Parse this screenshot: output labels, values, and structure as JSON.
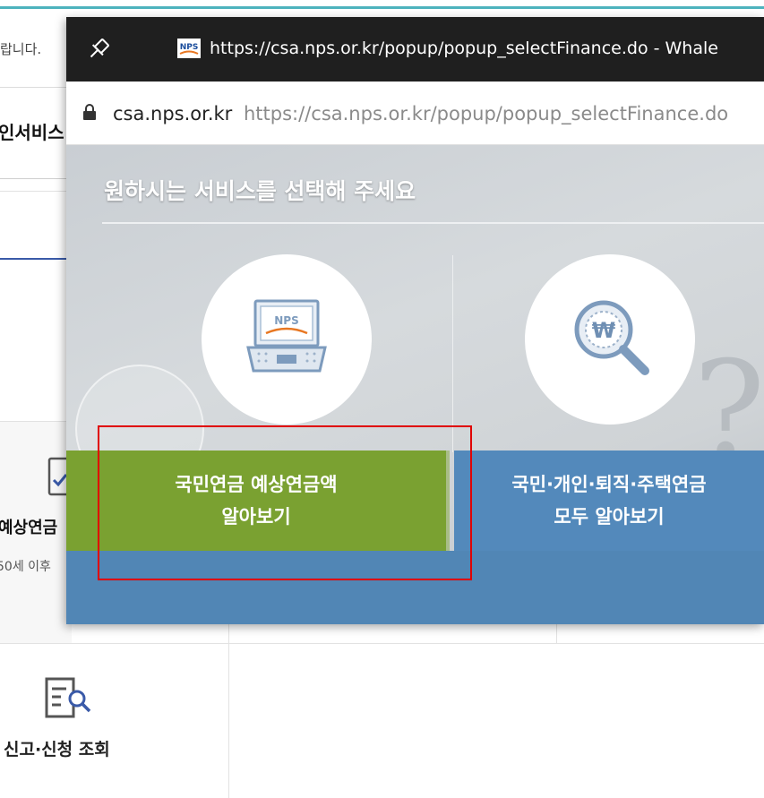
{
  "background_page": {
    "notice_fragment": "랍니다.",
    "service_title_fragment": "인서비스",
    "card": {
      "title_fragment": "예상연금",
      "desc_fragment": "50세 이후"
    },
    "report_label": "신고·신청 조회"
  },
  "popup": {
    "window_title": "https://csa.nps.or.kr/popup/popup_selectFinance.do - Whale",
    "address": {
      "domain": "csa.nps.or.kr",
      "url": "https://csa.nps.or.kr/popup/popup_selectFinance.do"
    },
    "heading": "원하시는 서비스를 선택해 주세요",
    "options": [
      {
        "line1": "국민연금 예상연금액",
        "line2": "알아보기",
        "color": "#7aa131",
        "icon": "laptop-icon"
      },
      {
        "line1": "국민·개인·퇴직·주택연금",
        "line2": "모두 알아보기",
        "color": "#5389bb",
        "icon": "magnifier-won-icon"
      }
    ],
    "favicon_text": "NPS",
    "laptop_screen_text": "NPS",
    "won_symbol": "₩"
  },
  "colors": {
    "accent_teal": "#4db3bd",
    "highlight_red": "#e00000",
    "titlebar": "#1f1f1f"
  }
}
